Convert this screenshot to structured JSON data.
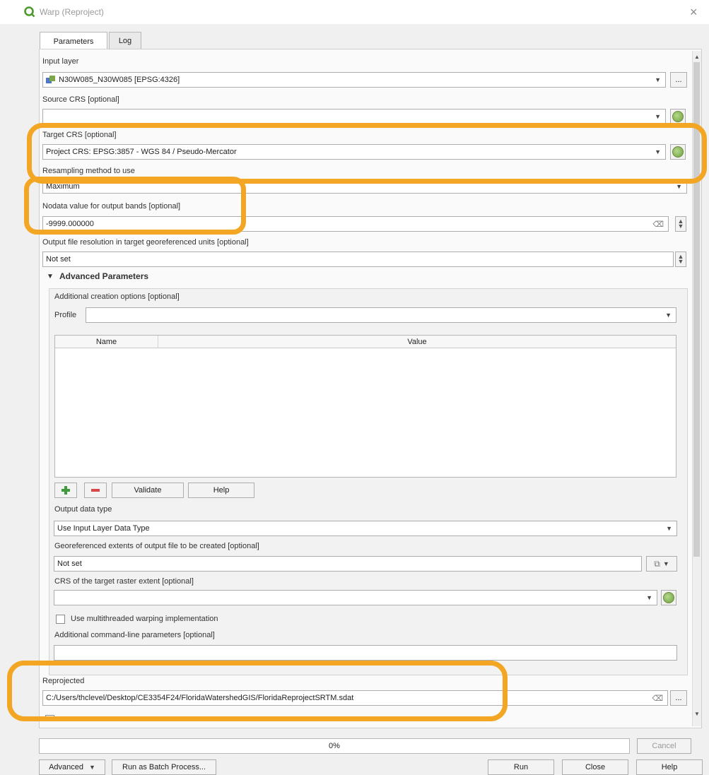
{
  "window": {
    "title": "Warp (Reproject)",
    "close_glyph": "×"
  },
  "tabs": [
    {
      "label": "Parameters"
    },
    {
      "label": "Log"
    }
  ],
  "params": {
    "input_layer": {
      "label": "Input layer",
      "value": "N30W085_N30W085 [EPSG:4326]",
      "browse": "..."
    },
    "source_crs": {
      "label": "Source CRS [optional]",
      "value": ""
    },
    "target_crs": {
      "label": "Target CRS [optional]",
      "value": "Project CRS: EPSG:3857 - WGS 84 / Pseudo-Mercator"
    },
    "resampling": {
      "label": "Resampling method to use",
      "value": "Maximum"
    },
    "nodata": {
      "label": "Nodata value for output bands [optional]",
      "value": "-9999.000000"
    },
    "resolution": {
      "label": "Output file resolution in target georeferenced units [optional]",
      "value": "Not set"
    }
  },
  "advanced": {
    "header": "Advanced Parameters",
    "creation_label": "Additional creation options [optional]",
    "profile_label": "Profile",
    "profile_value": "",
    "table_headers": [
      "Name",
      "Value"
    ],
    "validate": "Validate",
    "help": "Help",
    "data_type_label": "Output data type",
    "data_type_value": "Use Input Layer Data Type",
    "extent_label": "Georeferenced extents of output file to be created [optional]",
    "extent_value": "Not set",
    "extent_crs_label": "CRS of the target raster extent [optional]",
    "extent_crs_value": "",
    "multithread_label": "Use multithreaded warping implementation",
    "multithread_checked": false,
    "cmdline_label": "Additional command-line parameters [optional]",
    "cmdline_value": ""
  },
  "output": {
    "label": "Reprojected",
    "value": "C:/Users/thclevel/Desktop/CE3354F24/FloridaWatershedGIS/FloridaReprojectSRTM.sdat",
    "browse": "..."
  },
  "progress": {
    "text": "0%",
    "fraction": 0
  },
  "buttons": {
    "cancel": "Cancel",
    "advanced": "Advanced",
    "batch": "Run as Batch Process...",
    "run": "Run",
    "close": "Close",
    "help": "Help"
  },
  "icons": {
    "app": "qgis-icon",
    "layer": "raster-layer-icon",
    "crs": "crs-selector-icon",
    "add": "add-icon",
    "remove": "remove-icon"
  },
  "colors": {
    "highlight": "#f2a623"
  }
}
